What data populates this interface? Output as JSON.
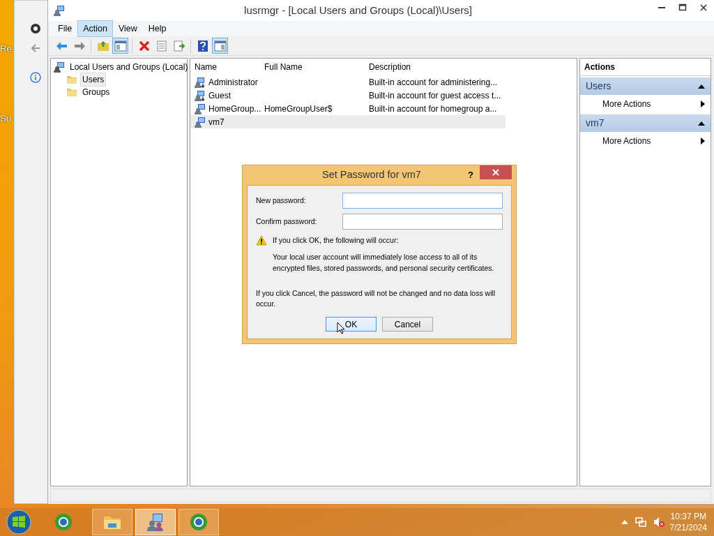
{
  "desktop": {
    "icon_labels": [
      "Re",
      "Su"
    ]
  },
  "window": {
    "title": "lusrmgr - [Local Users and Groups (Local)\\Users]",
    "menu": [
      {
        "label": "File",
        "selected": false
      },
      {
        "label": "Action",
        "selected": true
      },
      {
        "label": "View",
        "selected": false
      },
      {
        "label": "Help",
        "selected": false
      }
    ],
    "toolbar": [
      {
        "kind": "back"
      },
      {
        "kind": "forward"
      },
      {
        "kind": "sep"
      },
      {
        "kind": "up"
      },
      {
        "kind": "tree",
        "pressed": true
      },
      {
        "kind": "sep"
      },
      {
        "kind": "delete"
      },
      {
        "kind": "properties"
      },
      {
        "kind": "export"
      },
      {
        "kind": "sep"
      },
      {
        "kind": "help"
      },
      {
        "kind": "actionpane",
        "pressed": true
      }
    ],
    "tree": {
      "label": "Local Users and Groups (Local)",
      "children": [
        {
          "label": "Users",
          "selected": true
        },
        {
          "label": "Groups",
          "selected": false
        }
      ]
    },
    "table": {
      "columns": [
        "Name",
        "Full Name",
        "Description"
      ],
      "rows": [
        {
          "name": "Administrator",
          "full_name": "",
          "description": "Built-in account for administering...",
          "kind": "builtin",
          "selected": false
        },
        {
          "name": "Guest",
          "full_name": "",
          "description": "Built-in account for guest access t...",
          "kind": "builtin",
          "selected": false
        },
        {
          "name": "HomeGroup...",
          "full_name": "HomeGroupUser$",
          "description": "Built-in account for homegroup a...",
          "kind": "user",
          "selected": false
        },
        {
          "name": "vm7",
          "full_name": "",
          "description": "",
          "kind": "user",
          "selected": true
        }
      ]
    },
    "actions": {
      "title": "Actions",
      "sections": [
        {
          "title": "Users",
          "expanded": true,
          "items": [
            "More Actions"
          ]
        },
        {
          "title": "vm7",
          "expanded": true,
          "items": [
            "More Actions"
          ]
        }
      ]
    }
  },
  "dialog": {
    "title": "Set Password for vm7",
    "help": "?",
    "fields": [
      {
        "label": "New password:",
        "focused": true
      },
      {
        "label": "Confirm password:",
        "focused": false
      }
    ],
    "warning": "If you click OK, the following will occur:",
    "warning_detail": "Your local user account will immediately lose access to all of its encrypted files, stored passwords, and personal security certificates.",
    "note": "If you click Cancel, the password will not be changed and no data loss will occur.",
    "buttons": [
      {
        "label": "OK",
        "default": true
      },
      {
        "label": "Cancel",
        "default": false
      }
    ]
  },
  "taskbar": {
    "apps": [
      {
        "kind": "browser",
        "running": false,
        "active": false
      },
      {
        "kind": "folder",
        "running": true,
        "active": false
      },
      {
        "kind": "users",
        "running": true,
        "active": true
      },
      {
        "kind": "browser",
        "running": true,
        "active": false
      }
    ],
    "clock": {
      "time": "10:37 PM",
      "date": "7/21/2024"
    }
  }
}
